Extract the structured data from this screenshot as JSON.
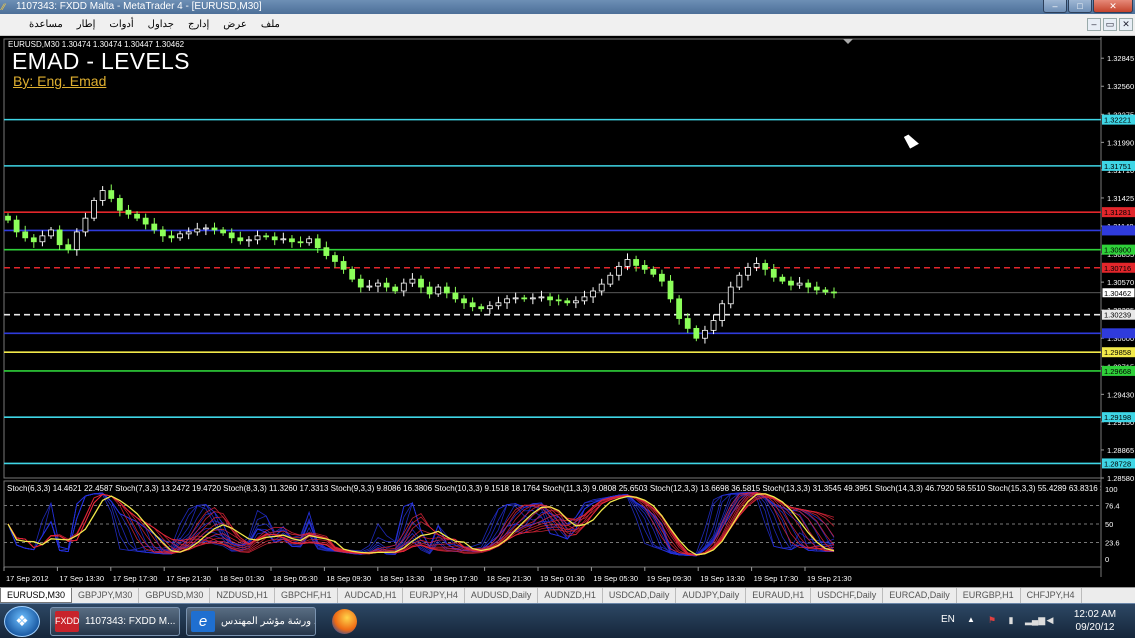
{
  "window": {
    "title": "1107343: FXDD Malta - MetaTrader 4 - [EURUSD,M30]",
    "controls": {
      "minimize": "–",
      "maximize": "□",
      "close": "✕"
    }
  },
  "menu": {
    "items": [
      "ملف",
      "عرض",
      "إدارج",
      "جداول",
      "أدوات",
      "إطار",
      "مساعدة"
    ],
    "mdi_controls": {
      "minimize": "–",
      "restore": "▭",
      "close": "✕"
    }
  },
  "chart": {
    "symbol_header": "EURUSD,M30  1.30474 1.30474 1.30447 1.30462",
    "indicator_title": "EMAD - LEVELS",
    "indicator_author": "By: Eng. Emad",
    "stoch_legend": "Stoch(6,3,3) 14.4621 22.4587  Stoch(7,3,3) 13.2472 19.4720  Stoch(8,3,3) 11.3260 17.3313  Stoch(9,3,3) 9.8086 16.3806  Stoch(10,3,3) 9.1518 18.1764  Stoch(11,3,3) 9.0808 25.6503  Stoch(12,3,3) 13.6698 36.5815  Stoch(13,3,3) 31.3545 49.3951  Stoch(14,3,3) 46.7920 58.5510  Stoch(15,3,3) 55.4289 63.8316  Stoch(16,3,3)",
    "colors": {
      "background": "#000000",
      "grid": "#5a5a5a",
      "bull": "#ffffff",
      "bear": "#8cff5a"
    }
  },
  "chart_data": {
    "type": "line",
    "price_axis": {
      "range": [
        1.2858,
        1.3304
      ],
      "tick_labels": [
        "1.32845",
        "1.32560",
        "1.32275",
        "1.31990",
        "1.31710",
        "1.31425",
        "1.31140",
        "1.30855",
        "1.30570",
        "1.30285",
        "1.30000",
        "1.29715",
        "1.29430",
        "1.29150",
        "1.28865",
        "1.28580"
      ]
    },
    "levels": [
      {
        "price": 1.32221,
        "label": "1.32221",
        "color": "#3fd6e6",
        "style": "solid"
      },
      {
        "price": 1.31751,
        "label": "1.31751",
        "color": "#3fd6e6",
        "style": "solid"
      },
      {
        "price": 1.31281,
        "label": "1.31281",
        "color": "#e3262b",
        "style": "solid"
      },
      {
        "price": 1.31095,
        "label": "",
        "color": "#2f3bdc",
        "style": "solid"
      },
      {
        "price": 1.309,
        "label": "1.30900",
        "color": "#2fd13a",
        "style": "solid"
      },
      {
        "price": 1.30716,
        "label": "1.30716",
        "color": "#e3262b",
        "style": "dashed"
      },
      {
        "price": 1.30239,
        "label": "1.30239",
        "color": "#e8e8e8",
        "style": "dashed"
      },
      {
        "price": 1.3005,
        "label": "",
        "color": "#2f3bdc",
        "style": "solid"
      },
      {
        "price": 1.29858,
        "label": "1.29858",
        "color": "#f2e94a",
        "style": "solid"
      },
      {
        "price": 1.29668,
        "label": "1.29668",
        "color": "#2fd13a",
        "style": "solid"
      },
      {
        "price": 1.29198,
        "label": "1.29198",
        "color": "#3fd6e6",
        "style": "solid"
      },
      {
        "price": 1.28728,
        "label": "1.28728",
        "color": "#3fd6e6",
        "style": "solid"
      }
    ],
    "current_price": {
      "value": 1.30462,
      "label": "1.30462"
    },
    "series": [
      {
        "type": "candlestick",
        "close_path": [
          1.312,
          1.3108,
          1.3102,
          1.3098,
          1.3104,
          1.311,
          1.3095,
          1.309,
          1.3108,
          1.3122,
          1.314,
          1.315,
          1.3142,
          1.313,
          1.3126,
          1.3122,
          1.3116,
          1.311,
          1.3104,
          1.3102,
          1.3106,
          1.3108,
          1.3111,
          1.3112,
          1.311,
          1.3107,
          1.3102,
          1.3099,
          1.31,
          1.3104,
          1.3103,
          1.31,
          1.3101,
          1.3098,
          1.3097,
          1.3101,
          1.3092,
          1.3084,
          1.3078,
          1.307,
          1.306,
          1.3052,
          1.3053,
          1.3056,
          1.3052,
          1.3048,
          1.3056,
          1.306,
          1.3052,
          1.3045,
          1.3052,
          1.3046,
          1.304,
          1.3036,
          1.3032,
          1.303,
          1.3033,
          1.3036,
          1.304,
          1.3041,
          1.304,
          1.3041,
          1.3042,
          1.3039,
          1.3038,
          1.3036,
          1.3038,
          1.3042,
          1.3048,
          1.3055,
          1.3064,
          1.3073,
          1.308,
          1.3074,
          1.307,
          1.3065,
          1.3058,
          1.304,
          1.302,
          1.301,
          1.3,
          1.3008,
          1.3018,
          1.3035,
          1.3052,
          1.3064,
          1.3072,
          1.3076,
          1.307,
          1.3062,
          1.3058,
          1.3054,
          1.3056,
          1.3052,
          1.3049,
          1.3047,
          1.3046
        ]
      },
      {
        "type": "stochastic",
        "y_range": [
          0,
          100
        ],
        "y_labels": [
          "100",
          "76.4",
          "50",
          "23.6",
          "0"
        ],
        "y_values": [
          100,
          76.4,
          50,
          23.6,
          0
        ],
        "lines": 11,
        "colors": {
          "fast": "#2530d8",
          "slow": "#e0263a",
          "signal": "#f2e94a"
        }
      }
    ],
    "time_labels": [
      "17 Sep 2012",
      "17 Sep 13:30",
      "17 Sep 17:30",
      "17 Sep 21:30",
      "18 Sep 01:30",
      "18 Sep 05:30",
      "18 Sep 09:30",
      "18 Sep 13:30",
      "18 Sep 17:30",
      "18 Sep 21:30",
      "19 Sep 01:30",
      "19 Sep 05:30",
      "19 Sep 09:30",
      "19 Sep 13:30",
      "19 Sep 17:30",
      "19 Sep 21:30"
    ]
  },
  "tabs": [
    "EURUSD,M30",
    "GBPJPY,M30",
    "GBPUSD,M30",
    "NZDUSD,H1",
    "GBPCHF,H1",
    "AUDCAD,H1",
    "EURJPY,H4",
    "AUDUSD,Daily",
    "AUDNZD,H1",
    "USDCAD,Daily",
    "AUDJPY,Daily",
    "EURAUD,H1",
    "USDCHF,Daily",
    "EURCAD,Daily",
    "EURGBP,H1",
    "CHFJPY,H4"
  ],
  "taskbar": {
    "start_glyph": "❖",
    "tasks": [
      {
        "label": "1107343: FXDD M...",
        "icon_text": "FXDD"
      },
      {
        "label": "ورشة مؤشر المهندس ...",
        "icon_text": "e"
      }
    ],
    "language": "EN",
    "tray_arrow": "▲",
    "clock_time": "12:02 AM",
    "clock_date": "09/20/12"
  }
}
